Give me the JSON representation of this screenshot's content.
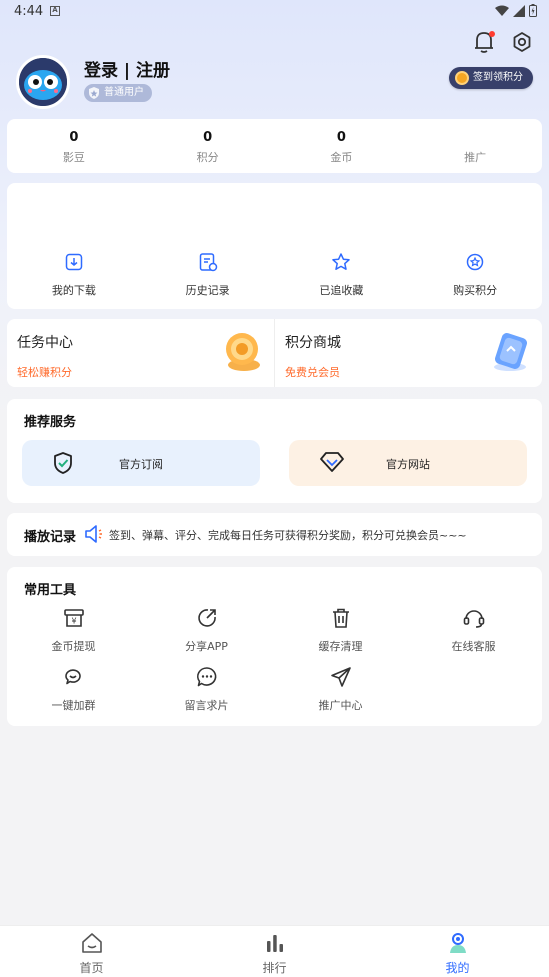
{
  "status_bar": {
    "time": "4:44"
  },
  "header": {
    "login_text": "登录 | 注册",
    "user_badge": "普通用户",
    "signin_button": "签到领积分"
  },
  "stats": [
    {
      "value": "0",
      "label": "影豆"
    },
    {
      "value": "0",
      "label": "积分"
    },
    {
      "value": "0",
      "label": "金币"
    },
    {
      "value": "",
      "label": "推广"
    }
  ],
  "quick_actions": [
    {
      "label": "我的下载",
      "icon": "download-icon"
    },
    {
      "label": "历史记录",
      "icon": "history-icon"
    },
    {
      "label": "已追收藏",
      "icon": "star-icon"
    },
    {
      "label": "购买积分",
      "icon": "points-icon"
    }
  ],
  "promos": [
    {
      "title": "任务中心",
      "subtitle": "轻松赚积分",
      "icon": "coins-icon"
    },
    {
      "title": "积分商城",
      "subtitle": "免费兑会员",
      "icon": "card-icon"
    }
  ],
  "services": {
    "title": "推荐服务",
    "items": [
      {
        "label": "官方订阅",
        "icon": "shield-check-icon",
        "bg": "#e8f1fd"
      },
      {
        "label": "官方网站",
        "icon": "diamond-icon",
        "bg": "#fdf1e4"
      }
    ]
  },
  "history": {
    "title": "播放记录",
    "marquee": "签到、弹幕、评分、完成每日任务可获得积分奖励，积分可兑换会员~~~"
  },
  "tools": {
    "title": "常用工具",
    "items": [
      {
        "label": "金币提现",
        "icon": "withdraw-icon"
      },
      {
        "label": "分享APP",
        "icon": "share-icon"
      },
      {
        "label": "缓存清理",
        "icon": "trash-icon"
      },
      {
        "label": "在线客服",
        "icon": "headset-icon"
      },
      {
        "label": "一键加群",
        "icon": "group-chat-icon"
      },
      {
        "label": "留言求片",
        "icon": "message-icon"
      },
      {
        "label": "推广中心",
        "icon": "send-icon"
      }
    ]
  },
  "tabbar": [
    {
      "label": "首页",
      "icon": "home-icon"
    },
    {
      "label": "排行",
      "icon": "rank-icon"
    },
    {
      "label": "我的",
      "icon": "profile-icon",
      "active": true
    }
  ],
  "colors": {
    "accent": "#2f6bff",
    "orange": "#ff6a2b"
  }
}
